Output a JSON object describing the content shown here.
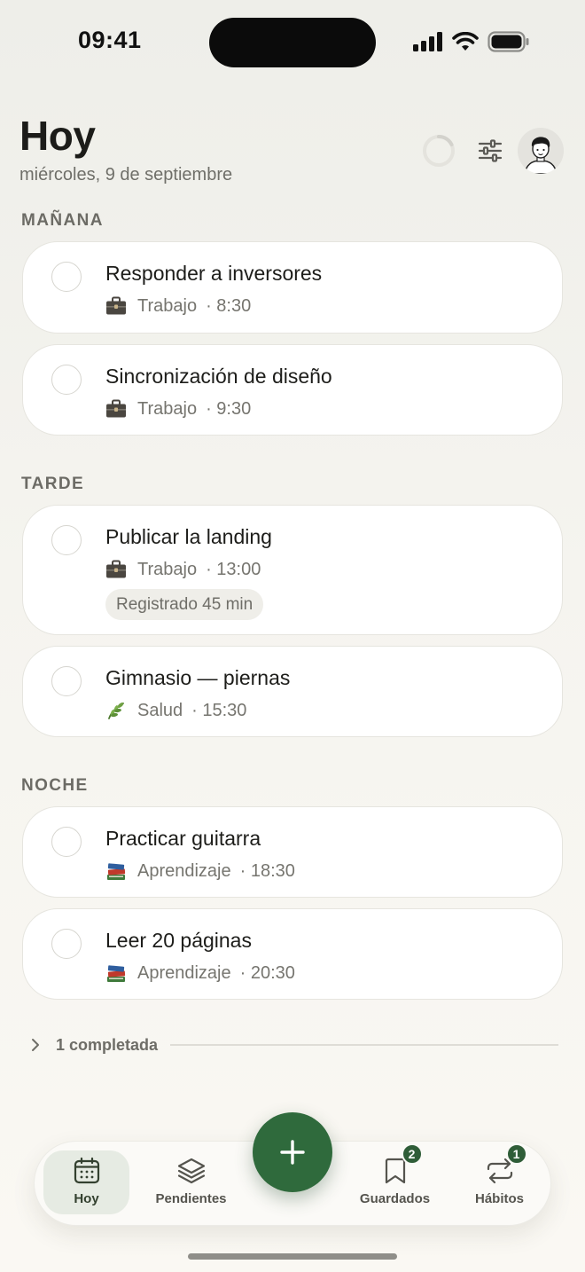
{
  "status": {
    "time": "09:41"
  },
  "header": {
    "title": "Hoy",
    "date": "miércoles, 9 de septiembre"
  },
  "sections": {
    "morning": "MAÑANA",
    "afternoon": "TARDE",
    "night": "NOCHE"
  },
  "tasks": [
    {
      "title": "Responder a inversores",
      "category": "Trabajo",
      "time": "· 8:30",
      "icon": "briefcase-icon"
    },
    {
      "title": "Sincronización de diseño",
      "category": "Trabajo",
      "time": "· 9:30",
      "icon": "briefcase-icon"
    },
    {
      "title": "Publicar la landing",
      "category": "Trabajo",
      "time": "· 13:00",
      "icon": "briefcase-icon",
      "logged": "Registrado 45 min"
    },
    {
      "title": "Gimnasio — piernas",
      "category": "Salud",
      "time": "· 15:30",
      "icon": "leaf-icon"
    },
    {
      "title": "Practicar guitarra",
      "category": "Aprendizaje",
      "time": "· 18:30",
      "icon": "books-icon"
    },
    {
      "title": "Leer 20 páginas",
      "category": "Aprendizaje",
      "time": "· 20:30",
      "icon": "books-icon"
    }
  ],
  "completed": {
    "label": "1 completada"
  },
  "nav": {
    "today": "Hoy",
    "pending": "Pendientes",
    "saved": "Guardados",
    "saved_badge": "2",
    "habits": "Hábitos",
    "habits_badge": "1"
  },
  "colors": {
    "accent": "#2f6a3c",
    "badge": "#2f5d38",
    "background": "#f5f4ef"
  }
}
